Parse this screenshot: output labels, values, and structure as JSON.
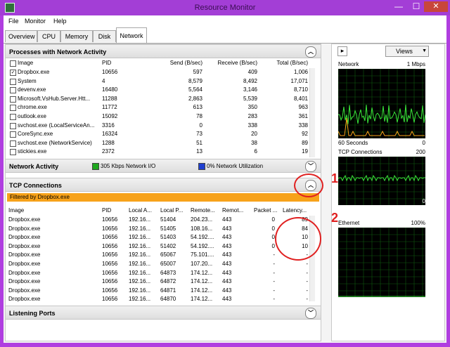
{
  "window": {
    "title": "Resource Monitor",
    "min_glyph": "—",
    "max_glyph": "☐",
    "close_glyph": "✕"
  },
  "menu": [
    "File",
    "Monitor",
    "Help"
  ],
  "tabs": [
    "Overview",
    "CPU",
    "Memory",
    "Disk",
    "Network"
  ],
  "processes": {
    "title": "Processes with Network Activity",
    "headers": [
      "Image",
      "PID",
      "Send (B/sec)",
      "Receive (B/sec)",
      "Total (B/sec)"
    ],
    "rows": [
      {
        "checked": true,
        "image": "Dropbox.exe",
        "pid": "10656",
        "send": "597",
        "recv": "409",
        "total": "1,006"
      },
      {
        "checked": false,
        "image": "System",
        "pid": "4",
        "send": "8,579",
        "recv": "8,492",
        "total": "17,071"
      },
      {
        "checked": false,
        "image": "devenv.exe",
        "pid": "16480",
        "send": "5,564",
        "recv": "3,146",
        "total": "8,710"
      },
      {
        "checked": false,
        "image": "Microsoft.VsHub.Server.Htt...",
        "pid": "11288",
        "send": "2,863",
        "recv": "5,539",
        "total": "8,401"
      },
      {
        "checked": false,
        "image": "chrome.exe",
        "pid": "11772",
        "send": "613",
        "recv": "350",
        "total": "963"
      },
      {
        "checked": false,
        "image": "outlook.exe",
        "pid": "15092",
        "send": "78",
        "recv": "283",
        "total": "361"
      },
      {
        "checked": false,
        "image": "svchost.exe (LocalServiceAn...",
        "pid": "3316",
        "send": "0",
        "recv": "338",
        "total": "338"
      },
      {
        "checked": false,
        "image": "CoreSync.exe",
        "pid": "16324",
        "send": "73",
        "recv": "20",
        "total": "92"
      },
      {
        "checked": false,
        "image": "svchost.exe (NetworkService)",
        "pid": "1288",
        "send": "51",
        "recv": "38",
        "total": "89"
      },
      {
        "checked": false,
        "image": "stickies.exe",
        "pid": "2372",
        "send": "13",
        "recv": "6",
        "total": "19"
      }
    ]
  },
  "network_activity": {
    "title": "Network Activity",
    "io_text": "305 Kbps Network I/O",
    "util_text": "0% Network Utilization",
    "io_color": "#1ea81e",
    "util_color": "#1f3fd0"
  },
  "tcp": {
    "title": "TCP Connections",
    "filter_text": "Filtered by Dropbox.exe",
    "headers": [
      "Image",
      "PID",
      "Local A...",
      "Local P...",
      "Remote...",
      "Remot...",
      "Packet ...",
      "Latency..."
    ],
    "rows": [
      [
        "Dropbox.exe",
        "10656",
        "192.16...",
        "51404",
        "204.23...",
        "443",
        "0",
        "89"
      ],
      [
        "Dropbox.exe",
        "10656",
        "192.16...",
        "51405",
        "108.16...",
        "443",
        "0",
        "84"
      ],
      [
        "Dropbox.exe",
        "10656",
        "192.16...",
        "51403",
        "54.192....",
        "443",
        "0",
        "10"
      ],
      [
        "Dropbox.exe",
        "10656",
        "192.16...",
        "51402",
        "54.192....",
        "443",
        "0",
        "10"
      ],
      [
        "Dropbox.exe",
        "10656",
        "192.16...",
        "65067",
        "75.101....",
        "443",
        "-",
        "-"
      ],
      [
        "Dropbox.exe",
        "10656",
        "192.16...",
        "65007",
        "107.20...",
        "443",
        "-",
        "-"
      ],
      [
        "Dropbox.exe",
        "10656",
        "192.16...",
        "64873",
        "174.12...",
        "443",
        "-",
        "-"
      ],
      [
        "Dropbox.exe",
        "10656",
        "192.16...",
        "64872",
        "174.12...",
        "443",
        "-",
        "-"
      ],
      [
        "Dropbox.exe",
        "10656",
        "192.16...",
        "64871",
        "174.12...",
        "443",
        "-",
        "-"
      ],
      [
        "Dropbox.exe",
        "10656",
        "192.16...",
        "64870",
        "174.12...",
        "443",
        "-",
        "-"
      ]
    ]
  },
  "listening": {
    "title": "Listening Ports"
  },
  "right_panel": {
    "views_label": "Views",
    "graphs": [
      {
        "name": "Network",
        "max": "1 Mbps",
        "footer_left": "60 Seconds",
        "footer_right": "0"
      },
      {
        "name": "TCP Connections",
        "max": "200",
        "footer_left": "",
        "footer_right": "0"
      },
      {
        "name": "Ethernet",
        "max": "100%",
        "footer_left": "",
        "footer_right": ""
      }
    ]
  },
  "annotations": [
    "1",
    "2"
  ],
  "glyphs": {
    "chevron_up": "︿",
    "chevron_down": "﹀",
    "expand_arrow": "▸",
    "dropdown": "▼",
    "check": "✓"
  }
}
